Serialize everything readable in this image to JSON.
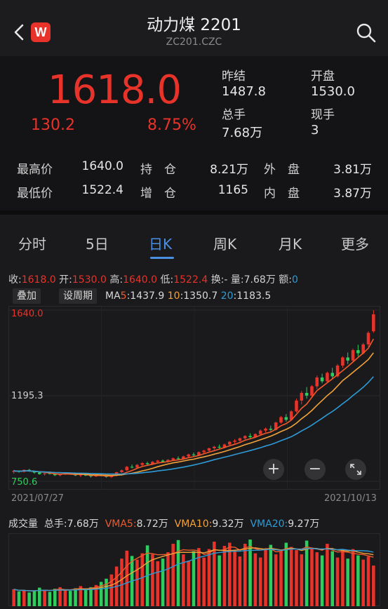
{
  "header": {
    "title": "动力煤 2201",
    "code": "ZC201.CZC",
    "logo_letter": "W"
  },
  "quote": {
    "price": "1618.0",
    "change": "130.2",
    "change_pct": "8.75%",
    "prev_close_label": "昨结",
    "prev_close": "1487.8",
    "open_label": "开盘",
    "open": "1530.0",
    "volume_label": "总手",
    "volume": "7.68万",
    "current_hand_label": "现手",
    "current_hand": "3"
  },
  "stats": {
    "high_label": "最高价",
    "high": "1640.0",
    "low_label": "最低价",
    "low": "1522.4",
    "oi_label": "持　仓",
    "oi": "8.21万",
    "oi_chg_label": "增　仓",
    "oi_chg": "1165",
    "outer_label": "外　盘",
    "outer": "3.81万",
    "inner_label": "内　盘",
    "inner": "3.87万"
  },
  "tabs": [
    "分时",
    "5日",
    "日K",
    "周K",
    "月K",
    "更多"
  ],
  "active_tab": "日K",
  "kline_info": {
    "close_label": "收:",
    "close": "1618.0",
    "open_label": "开:",
    "open": "1530.0",
    "high_label": "高:",
    "high": "1640.0",
    "low_label": "低:",
    "low": "1522.4",
    "turnover_label": "换:-",
    "vol_label": "量:",
    "vol": "7.68万",
    "amount_label": "额:",
    "amount": "0"
  },
  "ma": {
    "overlay_btn": "叠加",
    "period_btn": "设周期",
    "prefix": "MA",
    "ma5_label": "5",
    "ma5": ":1437.9",
    "ma10_label": "10",
    "ma10": ":1350.7",
    "ma20_label": "20",
    "ma20": ":1183.5"
  },
  "axis": {
    "top": "1640.0",
    "mid": "1195.3",
    "bottom": "750.6"
  },
  "dates": {
    "start": "2021/07/27",
    "end": "2021/10/13"
  },
  "volume_panel": {
    "title": "成交量",
    "total_label": "总手:",
    "total": "7.68万",
    "vma5_label": "VMA5:",
    "vma5": "8.72万",
    "vma10_label": "VMA10:",
    "vma10": "9.32万",
    "vma20_label": "VMA20:",
    "vma20": "9.27万"
  },
  "colors": {
    "up": "#e8332a",
    "down": "#2fcc5e",
    "ma5": "#ef5a2a",
    "ma10": "#f2a23a",
    "ma20": "#2e9bd6",
    "accent": "#4a90e2"
  },
  "icons": [
    "back-icon",
    "search-icon",
    "zoom-in-icon",
    "zoom-out-icon",
    "expand-icon"
  ],
  "candles": {
    "date_range": [
      "2021/07/27",
      "2021/10/13"
    ],
    "ohlc": [
      [
        800,
        810,
        790,
        805
      ],
      [
        805,
        808,
        795,
        800
      ],
      [
        800,
        812,
        796,
        810
      ],
      [
        810,
        815,
        800,
        803
      ],
      [
        803,
        806,
        790,
        796
      ],
      [
        796,
        800,
        785,
        788
      ],
      [
        788,
        795,
        780,
        792
      ],
      [
        792,
        798,
        786,
        789
      ],
      [
        789,
        792,
        778,
        782
      ],
      [
        782,
        790,
        776,
        788
      ],
      [
        788,
        796,
        783,
        793
      ],
      [
        793,
        796,
        785,
        787
      ],
      [
        787,
        792,
        778,
        781
      ],
      [
        781,
        788,
        772,
        786
      ],
      [
        786,
        790,
        778,
        780
      ],
      [
        780,
        785,
        770,
        776
      ],
      [
        776,
        784,
        772,
        782
      ],
      [
        782,
        788,
        776,
        779
      ],
      [
        779,
        783,
        770,
        773
      ],
      [
        773,
        782,
        768,
        780
      ],
      [
        780,
        800,
        776,
        798
      ],
      [
        798,
        812,
        794,
        808
      ],
      [
        808,
        830,
        804,
        826
      ],
      [
        826,
        838,
        818,
        822
      ],
      [
        822,
        840,
        818,
        836
      ],
      [
        836,
        850,
        830,
        845
      ],
      [
        845,
        852,
        835,
        840
      ],
      [
        840,
        856,
        836,
        852
      ],
      [
        852,
        862,
        846,
        858
      ],
      [
        858,
        864,
        848,
        852
      ],
      [
        852,
        866,
        848,
        862
      ],
      [
        862,
        874,
        856,
        870
      ],
      [
        870,
        880,
        862,
        866
      ],
      [
        866,
        884,
        862,
        880
      ],
      [
        880,
        894,
        874,
        890
      ],
      [
        890,
        900,
        880,
        886
      ],
      [
        886,
        906,
        882,
        902
      ],
      [
        902,
        914,
        896,
        910
      ],
      [
        910,
        926,
        904,
        922
      ],
      [
        922,
        936,
        914,
        930
      ],
      [
        930,
        942,
        920,
        926
      ],
      [
        926,
        946,
        922,
        942
      ],
      [
        942,
        960,
        936,
        956
      ],
      [
        956,
        970,
        946,
        962
      ],
      [
        962,
        978,
        954,
        974
      ],
      [
        974,
        990,
        968,
        986
      ],
      [
        986,
        1000,
        974,
        980
      ],
      [
        980,
        1000,
        976,
        996
      ],
      [
        996,
        1020,
        990,
        1014
      ],
      [
        1014,
        1030,
        1004,
        1024
      ],
      [
        1024,
        1040,
        1010,
        1018
      ],
      [
        1018,
        1060,
        1014,
        1056
      ],
      [
        1056,
        1090,
        1050,
        1084
      ],
      [
        1084,
        1100,
        1060,
        1070
      ],
      [
        1070,
        1120,
        1066,
        1114
      ],
      [
        1114,
        1180,
        1108,
        1170
      ],
      [
        1170,
        1220,
        1150,
        1210
      ],
      [
        1210,
        1240,
        1180,
        1196
      ],
      [
        1196,
        1250,
        1190,
        1244
      ],
      [
        1244,
        1300,
        1230,
        1290
      ],
      [
        1290,
        1310,
        1260,
        1270
      ],
      [
        1270,
        1320,
        1262,
        1314
      ],
      [
        1314,
        1340,
        1280,
        1296
      ],
      [
        1296,
        1360,
        1290,
        1352
      ],
      [
        1352,
        1400,
        1340,
        1394
      ],
      [
        1394,
        1420,
        1360,
        1378
      ],
      [
        1378,
        1440,
        1370,
        1432
      ],
      [
        1432,
        1460,
        1400,
        1416
      ],
      [
        1416,
        1470,
        1410,
        1462
      ],
      [
        1462,
        1530,
        1450,
        1522
      ],
      [
        1530,
        1640,
        1522,
        1618
      ]
    ],
    "volume": [
      3.2,
      2.8,
      3.0,
      2.6,
      2.9,
      3.5,
      3.1,
      2.7,
      3.3,
      3.6,
      3.0,
      2.9,
      3.4,
      3.8,
      3.2,
      3.6,
      4.0,
      4.6,
      5.2,
      6.0,
      7.5,
      9.0,
      10.5,
      9.5,
      8.8,
      10.0,
      11.5,
      9.8,
      8.5,
      9.0,
      10.2,
      11.8,
      12.5,
      9.8,
      8.6,
      10.4,
      11.0,
      9.2,
      10.8,
      12.2,
      9.6,
      11.4,
      12.0,
      10.6,
      9.4,
      11.8,
      12.6,
      10.0,
      9.2,
      10.8,
      11.6,
      9.8,
      10.4,
      12.0,
      11.2,
      10.6,
      9.8,
      12.4,
      11.0,
      10.2,
      9.6,
      11.8,
      10.4,
      9.2,
      10.6,
      9.0,
      10.8,
      9.6,
      8.8,
      9.4,
      7.68
    ]
  }
}
